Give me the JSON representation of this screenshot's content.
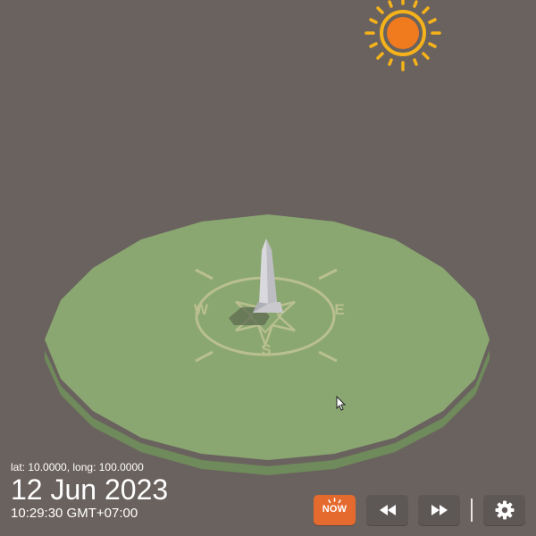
{
  "location": {
    "coordinates_text": "lat: 10.0000, long: 100.0000"
  },
  "datetime": {
    "date": "12 Jun 2023",
    "time": "10:29:30 GMT+07:00"
  },
  "compass": {
    "north": "N",
    "south": "S",
    "east": "E",
    "west": "W"
  },
  "controls": {
    "now_label": "NOW"
  },
  "icons": {
    "sun": "sun-icon",
    "now": "now-icon",
    "rewind": "rewind-icon",
    "fast_forward": "fast-forward-icon",
    "settings": "gear-icon",
    "cursor": "mouse-cursor-icon"
  },
  "colors": {
    "background": "#6a625e",
    "ground": "#8aa772",
    "ground_edge": "#6f8a5b",
    "compass_lines": "#b9bf8f",
    "sun_orange": "#f07a1e",
    "sun_rays": "#f6b21a",
    "now_button": "#e56a2e",
    "button": "#5d5755"
  }
}
